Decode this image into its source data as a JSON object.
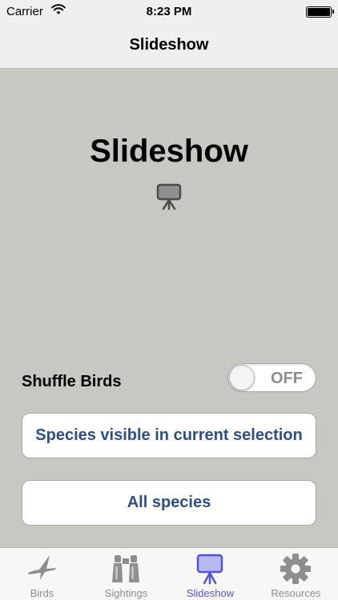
{
  "status_bar": {
    "carrier": "Carrier",
    "time": "8:23 PM"
  },
  "nav": {
    "title": "Slideshow"
  },
  "hero": {
    "title": "Slideshow",
    "icon": "projector-screen-icon"
  },
  "shuffle": {
    "label": "Shuffle Birds",
    "toggle_text": "OFF",
    "is_on": false
  },
  "buttons": {
    "species_visible": "Species visible in current selection",
    "all_species": "All species"
  },
  "tabs": [
    {
      "label": "Birds",
      "icon": "bird-icon",
      "active": false
    },
    {
      "label": "Sightings",
      "icon": "binoculars-icon",
      "active": false
    },
    {
      "label": "Slideshow",
      "icon": "projector-screen-icon",
      "active": true
    },
    {
      "label": "Resources",
      "icon": "gear-icon",
      "active": false
    }
  ],
  "colors": {
    "background": "#c8c7c2",
    "accent": "#5656cc",
    "button_text": "#2e4f80",
    "inactive_tab": "#8e8e8e"
  }
}
